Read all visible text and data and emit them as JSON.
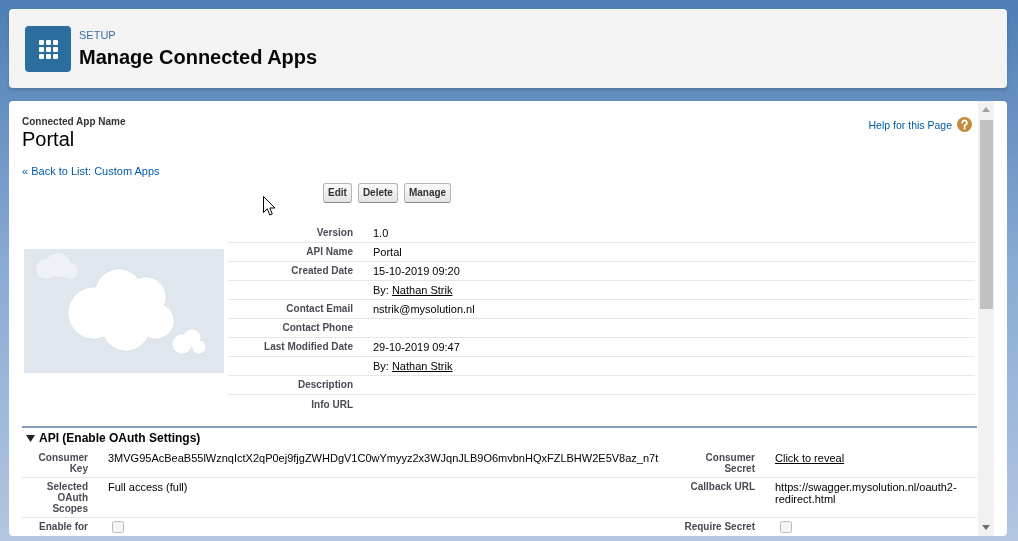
{
  "header": {
    "eyebrow": "SETUP",
    "title": "Manage Connected Apps"
  },
  "record": {
    "type_label": "Connected App Name",
    "name": "Portal",
    "help_link": "Help for this Page",
    "back_link": "« Back to List: Custom Apps"
  },
  "buttons": [
    "Edit",
    "Delete",
    "Manage"
  ],
  "details": [
    {
      "kind": "text",
      "label": "Version",
      "value": "1.0"
    },
    {
      "kind": "text",
      "label": "API Name",
      "value": "Portal"
    },
    {
      "kind": "text",
      "label": "Created Date",
      "value": "15-10-2019 09:20"
    },
    {
      "kind": "user",
      "prefix": "By:",
      "user": "Nathan Strik"
    },
    {
      "kind": "text",
      "label": "Contact Email",
      "value": "nstrik@mysolution.nl"
    },
    {
      "kind": "text",
      "label": "Contact Phone"
    },
    {
      "kind": "text",
      "label": "Last Modified Date",
      "value": "29-10-2019 09:47"
    },
    {
      "kind": "user",
      "prefix": "By:",
      "user": "Nathan Strik"
    },
    {
      "kind": "text",
      "label": "Description"
    },
    {
      "kind": "text",
      "label": "Info URL"
    }
  ],
  "sections": [
    {
      "title": "API (Enable OAuth Settings)",
      "expanded": true,
      "rows": [
        [
          {
            "label": "Consumer Key",
            "kind": "text",
            "value": "3MVG95AcBeaB55lWznqIctX2qP0ej9fjgZWHDgV1C0wYmyyz2x3WJqnJLB9O6mvbnHQxFZLBHW2E5V8az_n7t"
          },
          {
            "label": "Consumer Secret",
            "kind": "link",
            "value": "Click to reveal"
          }
        ],
        [
          {
            "label": "Selected OAuth Scopes",
            "kind": "text",
            "value": "Full access (full)"
          },
          {
            "label": "Callback URL",
            "kind": "text",
            "value": "https://swagger.mysolution.nl/oauth2-redirect.html"
          }
        ],
        [
          {
            "label": "Enable for",
            "kind": "checkbox"
          },
          {
            "label": "Require Secret",
            "kind": "checkbox"
          }
        ]
      ]
    }
  ]
}
